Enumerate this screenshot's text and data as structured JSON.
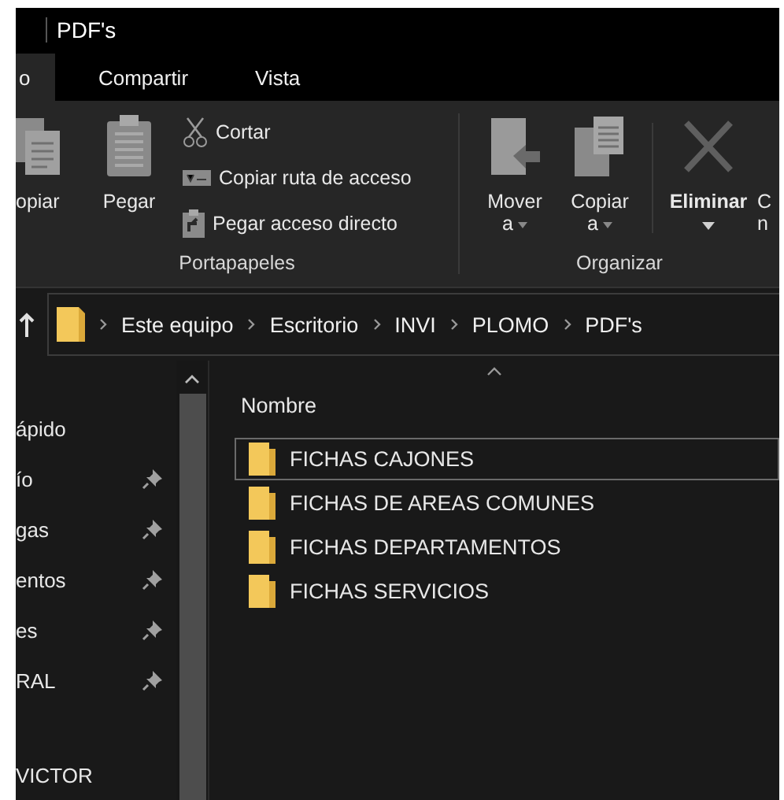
{
  "window": {
    "title": "PDF's"
  },
  "tabs": [
    {
      "label": "o",
      "selected": true
    },
    {
      "label": "Compartir",
      "selected": false
    },
    {
      "label": "Vista",
      "selected": false
    }
  ],
  "ribbon": {
    "clipboard": {
      "label": "Portapapeles",
      "large_buttons": [
        {
          "kind": "copy",
          "label": "opiar"
        },
        {
          "kind": "paste",
          "label": "Pegar"
        }
      ],
      "small_buttons": [
        {
          "kind": "cut",
          "label": "Cortar"
        },
        {
          "kind": "path",
          "label": "Copiar ruta de acceso"
        },
        {
          "kind": "shortcut",
          "label": "Pegar acceso directo"
        }
      ]
    },
    "organize": {
      "label": "Organizar",
      "buttons": [
        {
          "kind": "move",
          "label": "Mover",
          "sub": "a",
          "dropdown": true
        },
        {
          "kind": "copyto",
          "label": "Copiar",
          "sub": "a",
          "dropdown": true
        },
        {
          "kind": "delete",
          "label": "Eliminar",
          "dropdown": true
        },
        {
          "kind": "rename",
          "label": "C",
          "sub": "n"
        }
      ]
    }
  },
  "address_bar": {
    "crumbs": [
      "Este equipo",
      "Escritorio",
      "INVI",
      "PLOMO",
      "PDF's"
    ]
  },
  "nav_pane": {
    "items": [
      {
        "label": "ápido",
        "pinned": false
      },
      {
        "label": "ío",
        "pinned": true
      },
      {
        "label": "gas",
        "pinned": true
      },
      {
        "label": "entos",
        "pinned": true
      },
      {
        "label": "es",
        "pinned": true
      },
      {
        "label": "RAL",
        "pinned": true
      },
      {
        "label": "VICTOR",
        "pinned": false
      }
    ]
  },
  "file_list": {
    "column": "Nombre",
    "rows": [
      {
        "name": "FICHAS CAJONES",
        "selected": true
      },
      {
        "name": "FICHAS DE AREAS COMUNES",
        "selected": false
      },
      {
        "name": "FICHAS DEPARTAMENTOS",
        "selected": false
      },
      {
        "name": "FICHAS SERVICIOS",
        "selected": false
      }
    ]
  }
}
